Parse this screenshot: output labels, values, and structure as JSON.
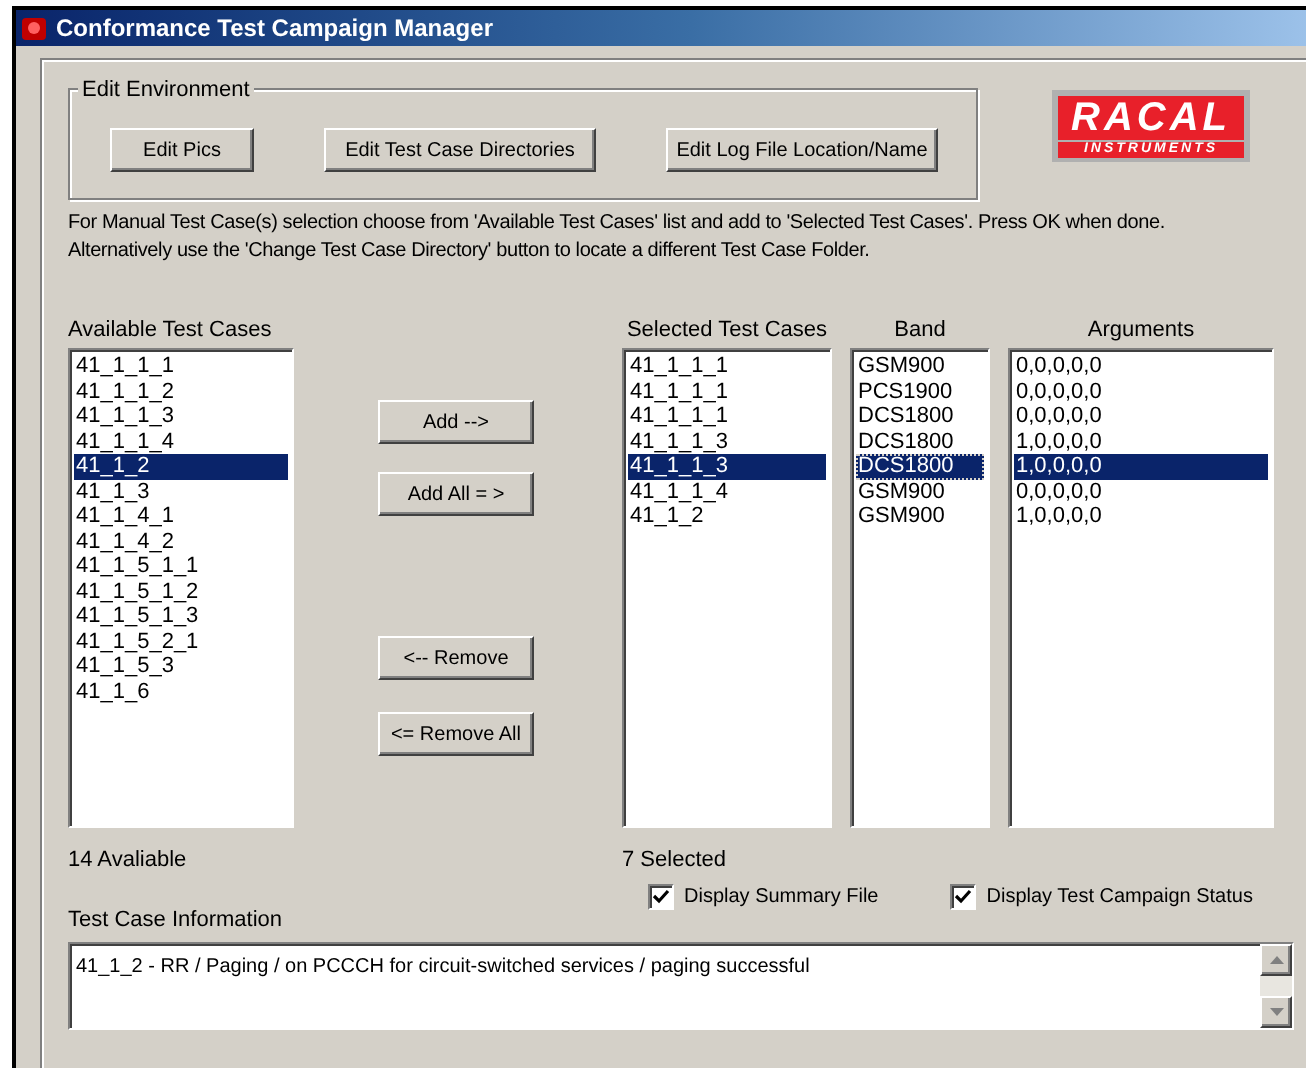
{
  "window": {
    "title": "Conformance Test Campaign Manager"
  },
  "edit_environment": {
    "title": "Edit Environment",
    "buttons": [
      "Edit Pics",
      "Edit Test Case Directories",
      "Edit Log File Location/Name"
    ]
  },
  "logo": {
    "name": "RACAL",
    "subtitle": "INSTRUMENTS"
  },
  "instructions": [
    "For Manual Test Case(s) selection choose from 'Available Test Cases' list and add to 'Selected Test Cases'. Press OK when done.",
    "Alternatively use the 'Change Test Case Directory' button to locate a different Test Case Folder."
  ],
  "available": {
    "heading": "Available Test Cases",
    "count": "14 Avaliable",
    "items": [
      {
        "label": "41_1_1_1",
        "selected": false
      },
      {
        "label": "41_1_1_2",
        "selected": false
      },
      {
        "label": "41_1_1_3",
        "selected": false
      },
      {
        "label": "41_1_1_4",
        "selected": false
      },
      {
        "label": "41_1_2",
        "selected": true
      },
      {
        "label": "41_1_3",
        "selected": false
      },
      {
        "label": "41_1_4_1",
        "selected": false
      },
      {
        "label": "41_1_4_2",
        "selected": false
      },
      {
        "label": "41_1_5_1_1",
        "selected": false
      },
      {
        "label": "41_1_5_1_2",
        "selected": false
      },
      {
        "label": "41_1_5_1_3",
        "selected": false
      },
      {
        "label": "41_1_5_2_1",
        "selected": false
      },
      {
        "label": "41_1_5_3",
        "selected": false
      },
      {
        "label": "41_1_6",
        "selected": false
      }
    ]
  },
  "move_buttons": [
    "Add -->",
    "Add All = >",
    "<-- Remove",
    "<= Remove All"
  ],
  "selected_lists": [
    {
      "heading": "Selected Test Cases",
      "items": [
        {
          "label": "41_1_1_1",
          "selected": false
        },
        {
          "label": "41_1_1_1",
          "selected": false
        },
        {
          "label": "41_1_1_1",
          "selected": false
        },
        {
          "label": "41_1_1_3",
          "selected": false
        },
        {
          "label": "41_1_1_3",
          "selected": true
        },
        {
          "label": "41_1_1_4",
          "selected": false
        },
        {
          "label": "41_1_2",
          "selected": false
        }
      ]
    },
    {
      "heading": "Band",
      "items": [
        {
          "label": "GSM900",
          "selected": false
        },
        {
          "label": "PCS1900",
          "selected": false
        },
        {
          "label": "DCS1800",
          "selected": false
        },
        {
          "label": "DCS1800",
          "selected": false
        },
        {
          "label": "DCS1800",
          "selected": true
        },
        {
          "label": "GSM900",
          "selected": false
        },
        {
          "label": "GSM900",
          "selected": false
        }
      ]
    },
    {
      "heading": "Arguments",
      "items": [
        {
          "label": "0,0,0,0,0",
          "selected": false
        },
        {
          "label": "0,0,0,0,0",
          "selected": false
        },
        {
          "label": "0,0,0,0,0",
          "selected": false
        },
        {
          "label": "1,0,0,0,0",
          "selected": false
        },
        {
          "label": "1,0,0,0,0",
          "selected": true
        },
        {
          "label": "0,0,0,0,0",
          "selected": false
        },
        {
          "label": "1,0,0,0,0",
          "selected": false
        }
      ]
    }
  ],
  "selected_count": "7 Selected",
  "options": [
    {
      "label": "Display Summary File",
      "checked": true
    },
    {
      "label": "Display Test Campaign Status",
      "checked": true
    }
  ],
  "info": {
    "label": "Test Case Information",
    "text": "41_1_2 -  RR / Paging / on PCCCH for circuit-switched services / paging successful"
  }
}
